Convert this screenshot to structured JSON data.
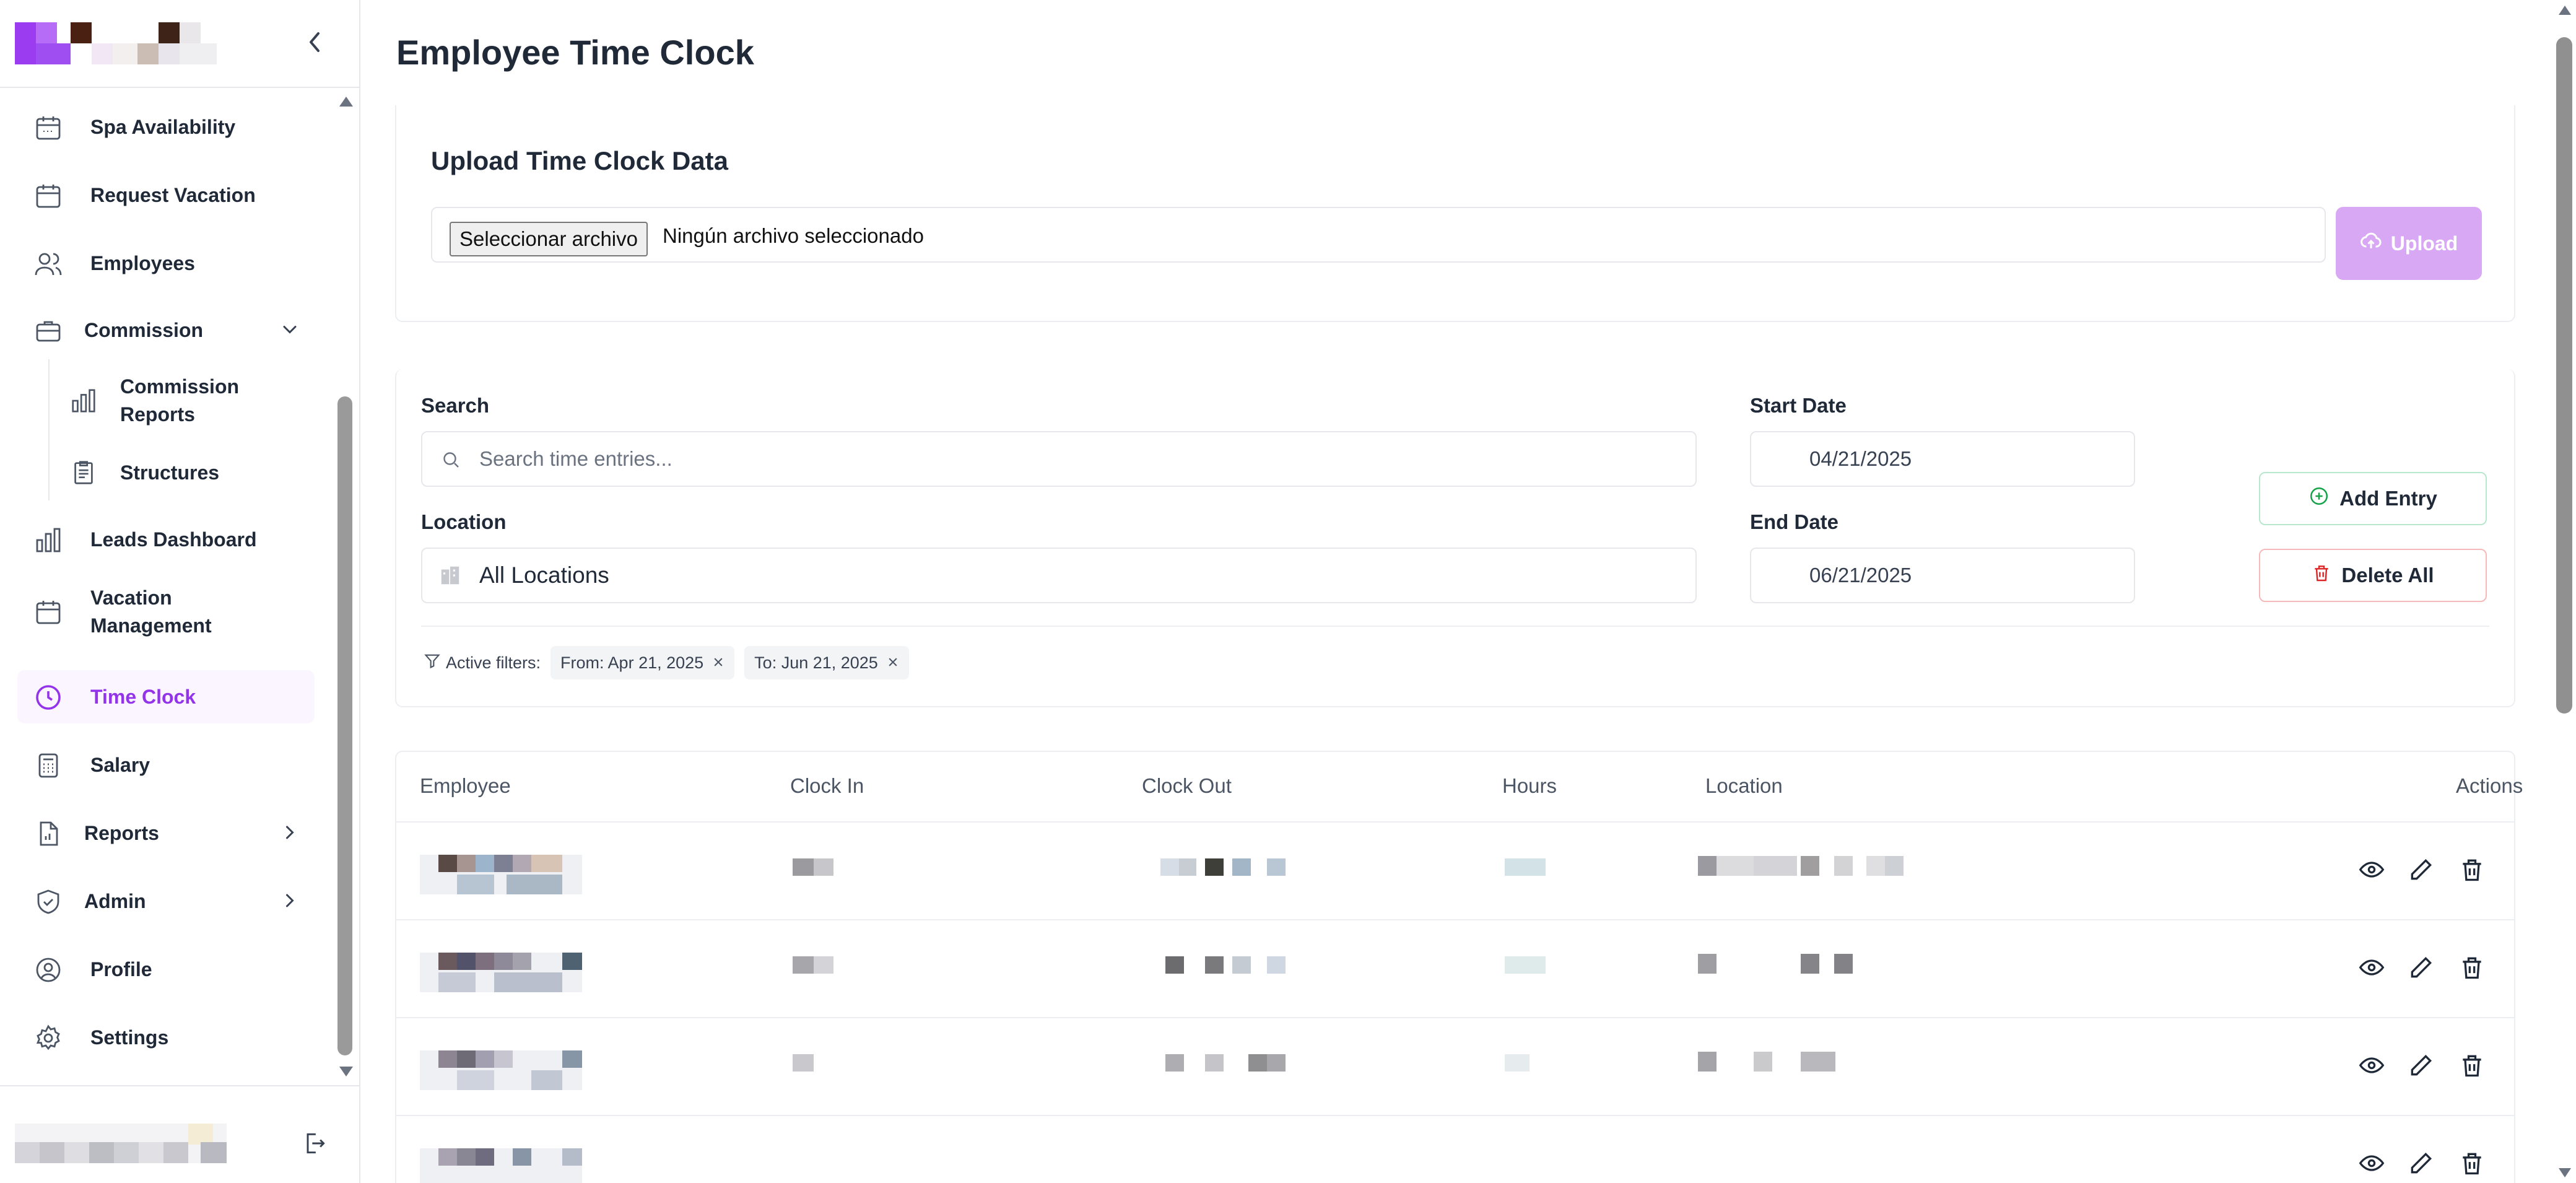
{
  "page": {
    "title": "Employee Time Clock"
  },
  "sidebar": {
    "collapse_icon": "chevron-left-icon",
    "items": [
      {
        "label": "Spa Availability",
        "icon": "calendar-icon"
      },
      {
        "label": "Request Vacation",
        "icon": "calendar-icon"
      },
      {
        "label": "Employees",
        "icon": "users-icon"
      },
      {
        "label": "Commission",
        "icon": "briefcase-icon",
        "expanded": true
      },
      {
        "label": "Commission Reports",
        "icon": "bar-chart-icon",
        "sub": true
      },
      {
        "label": "Structures",
        "icon": "clipboard-icon",
        "sub": true
      },
      {
        "label": "Leads Dashboard",
        "icon": "bar-chart-icon"
      },
      {
        "label": "Vacation Management",
        "icon": "calendar-icon"
      },
      {
        "label": "Time Clock",
        "icon": "clock-icon",
        "active": true
      },
      {
        "label": "Salary",
        "icon": "calculator-icon"
      },
      {
        "label": "Reports",
        "icon": "file-chart-icon"
      },
      {
        "label": "Admin",
        "icon": "shield-check-icon"
      },
      {
        "label": "Profile",
        "icon": "user-circle-icon"
      },
      {
        "label": "Settings",
        "icon": "gear-icon"
      }
    ],
    "logout_icon": "logout-icon"
  },
  "upload": {
    "title": "Upload Time Clock Data",
    "file_button": "Seleccionar archivo",
    "file_status": "Ningún archivo seleccionado",
    "upload_label": "Upload"
  },
  "filters": {
    "search_label": "Search",
    "search_placeholder": "Search time entries...",
    "start_label": "Start Date",
    "start_value": "04/21/2025",
    "location_label": "Location",
    "location_value": "All Locations",
    "end_label": "End Date",
    "end_value": "06/21/2025",
    "add_entry": "Add Entry",
    "delete_all": "Delete All",
    "active_label": "Active filters:",
    "chips": [
      "From: Apr 21, 2025",
      "To: Jun 21, 2025"
    ]
  },
  "table": {
    "columns": [
      "Employee",
      "Clock In",
      "Clock Out",
      "Hours",
      "Location",
      "Actions"
    ],
    "row_count": 4
  },
  "colors": {
    "accent": "#9333ea",
    "upload_btn": "#d8a8f4",
    "add_border": "#b7e8cd",
    "delete_border": "#f6b8b8"
  }
}
